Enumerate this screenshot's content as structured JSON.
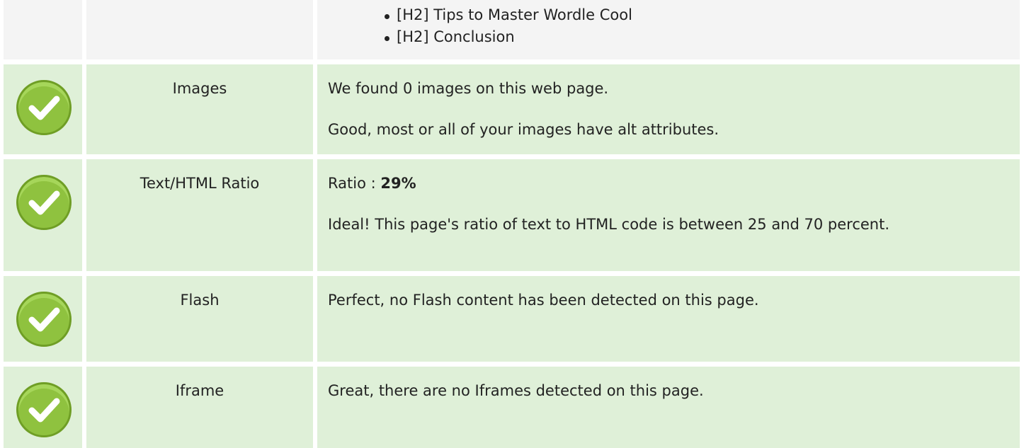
{
  "headings": {
    "items": [
      "[H2] Tips to Master Wordle Cool",
      "[H2] Conclusion"
    ]
  },
  "rows": [
    {
      "label": "Images",
      "line1": "We found 0 images on this web page.",
      "line2": "Good, most or all of your images have alt attributes."
    },
    {
      "label": "Text/HTML Ratio",
      "line1_prefix": "Ratio : ",
      "line1_value": "29%",
      "line2": "Ideal! This page's ratio of text to HTML code is between 25 and 70 percent."
    },
    {
      "label": "Flash",
      "line1": "Perfect, no Flash content has been detected on this page."
    },
    {
      "label": "Iframe",
      "line1": "Great, there are no Iframes detected on this page."
    }
  ],
  "icons": {
    "status": "check-circle-icon"
  },
  "colors": {
    "pass_background": "#dff0d8",
    "neutral_background": "#f4f4f4",
    "check_green": "#8fc23f"
  }
}
